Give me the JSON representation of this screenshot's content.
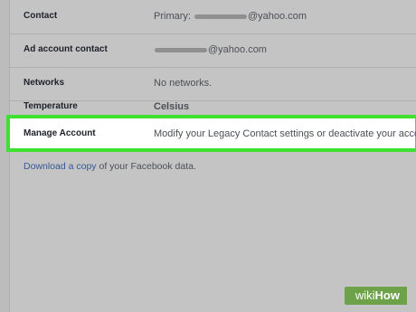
{
  "settings": {
    "rows": [
      {
        "label": "Contact",
        "value_prefix": "Primary:",
        "value_suffix": "@yahoo.com"
      },
      {
        "label": "Ad account contact",
        "value_suffix": "@yahoo.com"
      },
      {
        "label": "Networks",
        "value": "No networks."
      },
      {
        "label": "Temperature",
        "value": "Celsius"
      }
    ],
    "highlight": {
      "label": "Manage Account",
      "value": "Modify your Legacy Contact settings or deactivate your account."
    }
  },
  "download": {
    "prefix": "Download a copy",
    "suffix": "of your Facebook data."
  },
  "watermark": {
    "wiki": "wiki",
    "how": "How"
  },
  "colors": {
    "highlight_border": "#3ee12f",
    "link": "#365899",
    "watermark_bg": "#6ea24a"
  }
}
